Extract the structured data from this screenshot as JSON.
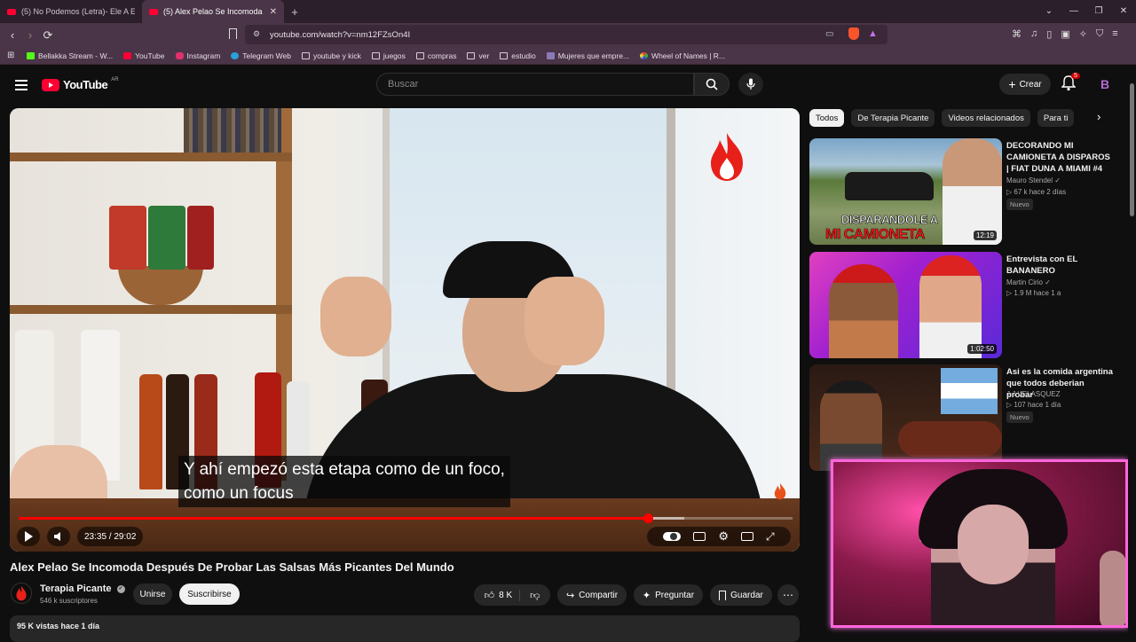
{
  "browser": {
    "tabs": [
      {
        "label": "(5) No Podemos (Letra)- Ele A El Dom"
      },
      {
        "label": "(5) Alex Pelao Se Incomoda Desp"
      }
    ],
    "new_tab": "+",
    "url": "youtube.com/watch?v=nm12FZsOn4I",
    "bookmarks": [
      {
        "label": "Bellakka Stream - W...",
        "icon": "kick-icon"
      },
      {
        "label": "YouTube",
        "icon": "youtube-icon"
      },
      {
        "label": "Instagram",
        "icon": "instagram-icon"
      },
      {
        "label": "Telegram Web",
        "icon": "telegram-icon"
      },
      {
        "label": "youtube y kick",
        "icon": "folder-icon"
      },
      {
        "label": "juegos",
        "icon": "folder-icon"
      },
      {
        "label": "compras",
        "icon": "folder-icon"
      },
      {
        "label": "ver",
        "icon": "folder-icon"
      },
      {
        "label": "estudio",
        "icon": "folder-icon"
      },
      {
        "label": "Mujeres que empre...",
        "icon": "m-icon"
      },
      {
        "label": "Wheel of Names | R...",
        "icon": "wheel-icon"
      }
    ]
  },
  "youtube": {
    "logo_text": "YouTube",
    "region": "AR",
    "search_placeholder": "Buscar",
    "create_label": "Crear",
    "notifications": "5",
    "avatar_letter": "B"
  },
  "player": {
    "subtitle": "Y ahí empezó esta etapa como de un foco,\ncomo un focus",
    "time": "23:35 / 29:02",
    "progress_fraction": 0.813,
    "buffered_fraction": 0.86
  },
  "video": {
    "title": "Alex Pelao Se Incomoda Después De Probar Las Salsas Más Picantes Del Mundo",
    "channel": "Terapia Picante",
    "subscribers": "546 k suscriptores",
    "join_label": "Unirse",
    "subscribe_label": "Suscribirse",
    "likes": "8 K",
    "share_label": "Compartir",
    "ask_label": "Preguntar",
    "save_label": "Guardar",
    "views": "95 K vistas  hace 1 día"
  },
  "sidebar": {
    "chips": [
      "Todos",
      "De Terapia Picante",
      "Videos relacionados",
      "Para ti"
    ],
    "recommendations": [
      {
        "title": "DECORANDO MI CAMIONETA A DISPAROS | FIAT DUNA A MIAMI #4",
        "channel": "Mauro Stendel",
        "meta": "67 k  hace 2 días",
        "badge": "Nuevo",
        "duration": "12:19",
        "thumb_text_1": "DISPARANDOLE A",
        "thumb_text_2": "MI CAMIONETA"
      },
      {
        "title": "Entrevista con EL BANANERO",
        "channel": "Martin Cirio",
        "meta": "1.9 M  hace 1 a",
        "badge": "",
        "duration": "1:02:50"
      },
      {
        "title": "Asi es la comida argentina que todos deberian probar",
        "channel": "J J VELASQUEZ",
        "meta": "107  hace 1 día",
        "badge": "Nuevo",
        "duration": ""
      }
    ]
  },
  "colors": {
    "accent": "#ff0033",
    "cam_border": "#ff66dd",
    "browser_bg": "#4a3447"
  }
}
